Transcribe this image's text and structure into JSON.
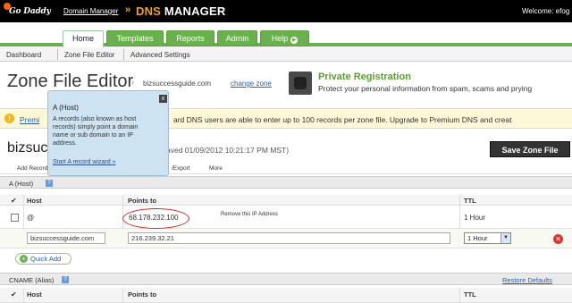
{
  "topbar": {
    "logo_text": "Go Daddy",
    "domain_manager_link": "Domain Manager",
    "separator": "»",
    "brand_prefix": "DNS",
    "brand_suffix": "MANAGER",
    "welcome": "Welcome: efog"
  },
  "tabs": [
    {
      "label": "Home",
      "active": true
    },
    {
      "label": "Templates"
    },
    {
      "label": "Reports"
    },
    {
      "label": "Admin"
    },
    {
      "label": "Help"
    }
  ],
  "subnav": {
    "items": [
      "Dashboard",
      "Zone File Editor",
      "Advanced Settings"
    ]
  },
  "zone": {
    "title": "Zone File Editor",
    "domain": "bizsuccessguide.com",
    "change_link": "change zone"
  },
  "promo": {
    "title": "Private Registration",
    "text": "Protect your personal information from spam, scams and prying"
  },
  "notice": {
    "premium_link": "Premi",
    "message": "ard DNS users are able to enter up to 100 records per zone file. Upgrade to Premium DNS and creat"
  },
  "domain_row": {
    "domain_partial": "bizsuc",
    "saved": "aved 01/09/2012 10:21:17 PM MST)",
    "save_button": "Save Zone File"
  },
  "toolbar": {
    "add_record": "Add Record",
    "export": "/Export",
    "more": "More"
  },
  "a_section": {
    "title": "A (Host)",
    "help": "?",
    "col_host": "Host",
    "col_points_to": "Points to",
    "col_ttl": "TTL",
    "check_header": "✔",
    "record": {
      "host": "@",
      "points_to": "68.178.232.100",
      "ttl": "1 Hour"
    },
    "annotation": "Remove this IP Address",
    "edit": {
      "host": "bizsuccessguide.com",
      "points_to": "216.239.32.21",
      "ttl": "1 Hour"
    },
    "quick_add": "Quick Add"
  },
  "cname_section": {
    "title": "CNAME (Alias)",
    "help": "?",
    "restore": "Restore Defaults",
    "col_host": "Host",
    "col_points_to": "Points to",
    "col_ttl": "TTL",
    "check_header": "✔"
  },
  "tooltip": {
    "close": "x",
    "title": "A (Host)",
    "body": "A records (also known as host records) simply point a domain name or sub domain to an IP address.",
    "link": "Start A record wizard »"
  }
}
